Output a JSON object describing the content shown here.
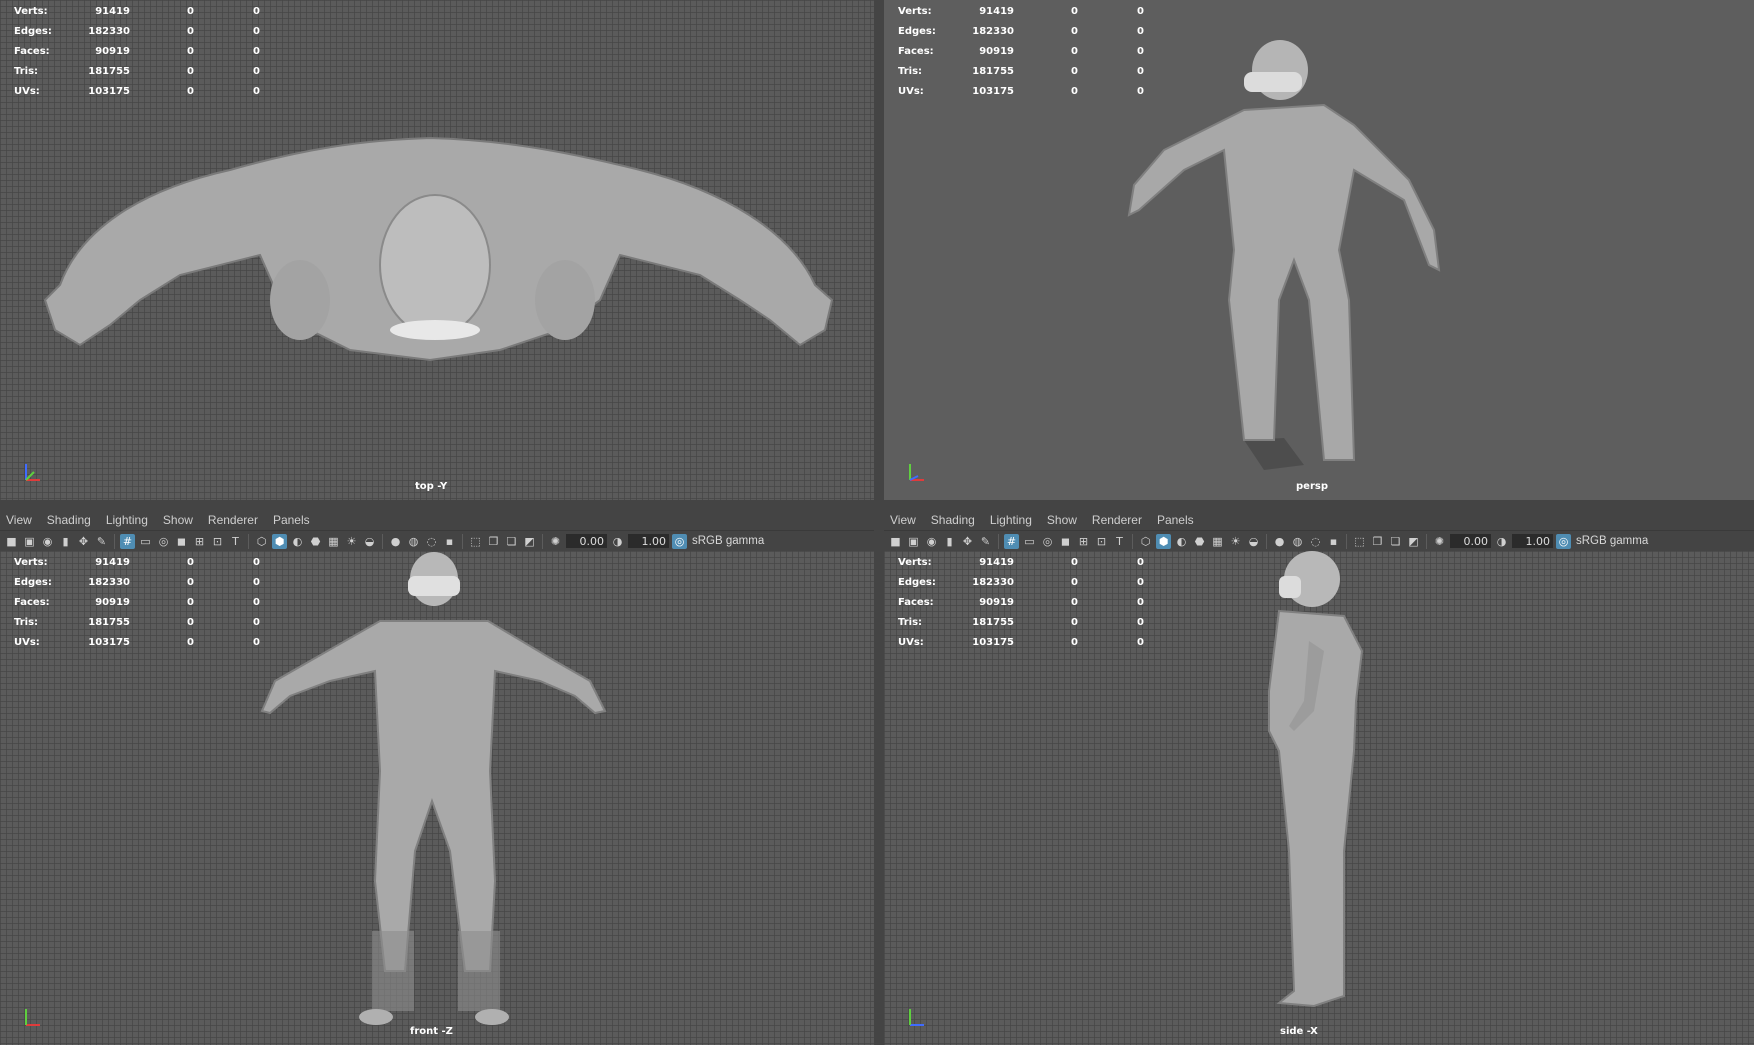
{
  "menus": [
    "View",
    "Shading",
    "Lighting",
    "Show",
    "Renderer",
    "Panels"
  ],
  "toolbar": {
    "exposure": "0.00",
    "gamma": "1.00",
    "color_space": "sRGB gamma"
  },
  "hud": {
    "rows": [
      {
        "label": "Verts:",
        "v1": "91419",
        "v2": "0",
        "v3": "0"
      },
      {
        "label": "Edges:",
        "v1": "182330",
        "v2": "0",
        "v3": "0"
      },
      {
        "label": "Faces:",
        "v1": "90919",
        "v2": "0",
        "v3": "0"
      },
      {
        "label": "Tris:",
        "v1": "181755",
        "v2": "0",
        "v3": "0"
      },
      {
        "label": "UVs:",
        "v1": "103175",
        "v2": "0",
        "v3": "0"
      }
    ]
  },
  "viewports": {
    "top": {
      "camera": "top -Y"
    },
    "persp": {
      "camera": "persp"
    },
    "front": {
      "camera": "front -Z"
    },
    "side": {
      "camera": "side -X"
    }
  },
  "colors": {
    "active_icon": "#4f8db3",
    "axis_x": "#e03b3b",
    "axis_y": "#5fcf3f",
    "axis_z": "#3f6bff"
  }
}
